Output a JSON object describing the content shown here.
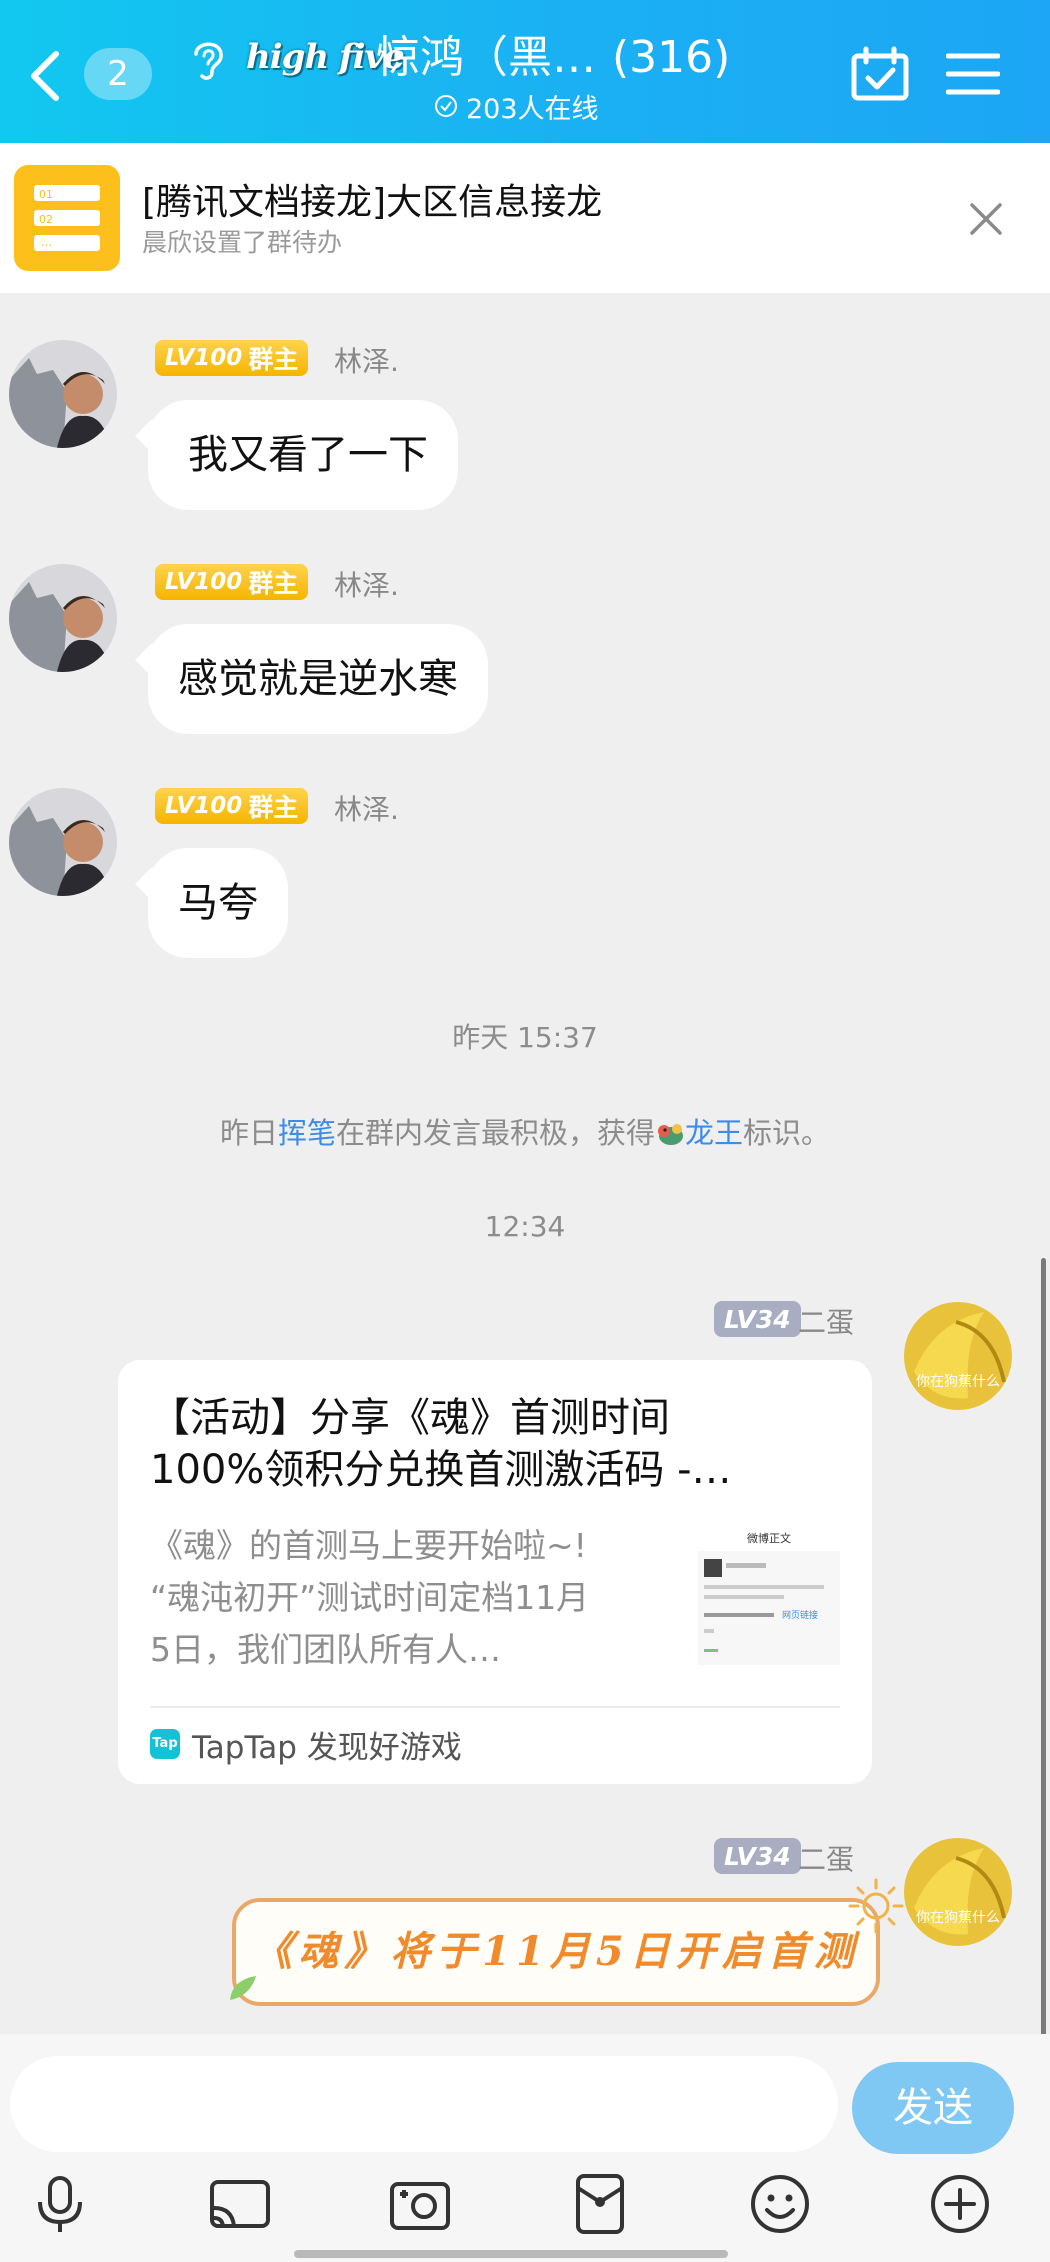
{
  "header": {
    "unread_count": "2",
    "brand_logo_text": "high five",
    "group_name": "惊鸿（黑…",
    "member_count": "(316)",
    "online_text": "203人在线"
  },
  "pinned": {
    "title": "[腾讯文档接龙]大区信息接龙",
    "subtitle": "晨欣设置了群待办"
  },
  "messages": [
    {
      "badge_level": "LV100",
      "badge_role": "群主",
      "sender": "林泽.",
      "text": "我又看了一下"
    },
    {
      "badge_level": "LV100",
      "badge_role": "群主",
      "sender": "林泽.",
      "text": "感觉就是逆水寒"
    },
    {
      "badge_level": "LV100",
      "badge_role": "群主",
      "sender": "林泽.",
      "text": "马夸"
    }
  ],
  "timestamp_1": "昨天 15:37",
  "system_note": {
    "before": "昨日",
    "user": "挥笔",
    "middle": "在群内发言最积极，获得",
    "title": "龙王",
    "after": "标识。"
  },
  "timestamp_2": "12:34",
  "outgoing": {
    "badge_level": "LV34",
    "sender": "二蛋",
    "avatar_text": "你在狗蕉什么"
  },
  "share_card": {
    "title_line1": "【活动】分享《魂》首测时间",
    "title_line2": "100%领积分兑换首测激活码 -…",
    "desc_line1": "《魂》的首测马上要开始啦~!",
    "desc_line2": "“魂沌初开”测试时间定档11月",
    "desc_line3": "5日，我们团队所有人…",
    "thumb_header": "微博正文",
    "thumb_link": "网页链接",
    "source_icon": "Tap",
    "source": "TapTap 发现好游戏"
  },
  "sticker_text": "《魂》将于11月5日开启首测",
  "input": {
    "send_label": "发送",
    "placeholder": ""
  },
  "colors": {
    "header_start": "#12c8f0",
    "header_end": "#1ca6f5",
    "send_button": "#7fc8f3",
    "highlight_link": "#3d8ce9",
    "owner_badge": "#f5b400",
    "member_badge": "#a9adc1"
  },
  "icons": [
    "back-arrow-icon",
    "ear-icon",
    "calendar-check-icon",
    "menu-icon",
    "close-icon",
    "clock-check-icon",
    "dragon-icon",
    "microphone-icon",
    "screen-cast-icon",
    "photo-icon",
    "red-packet-icon",
    "emoji-icon",
    "plus-icon"
  ]
}
